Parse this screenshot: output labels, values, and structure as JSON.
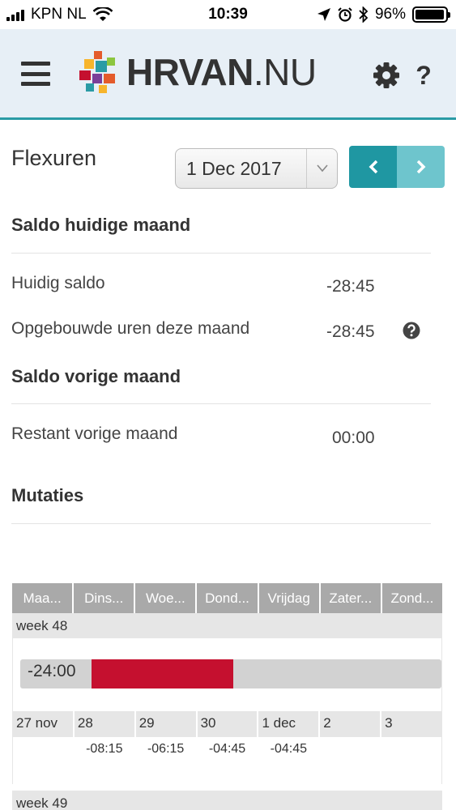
{
  "status_bar": {
    "carrier": "KPN NL",
    "time": "10:39",
    "battery_percent": "96%",
    "battery_level": 0.96
  },
  "header": {
    "logo_text_strong": "HRVAN",
    "logo_text_rest": ".NU",
    "help_label": "?"
  },
  "page": {
    "title": "Flexuren",
    "date_select_value": "1 Dec 2017"
  },
  "saldo_huidig": {
    "heading": "Saldo huidige maand",
    "rows": [
      {
        "label": "Huidig saldo",
        "value": "-28:45"
      },
      {
        "label": "Opgebouwde uren deze maand",
        "value": "-28:45"
      }
    ]
  },
  "saldo_vorig": {
    "heading": "Saldo vorige maand",
    "rows": [
      {
        "label": "Restant vorige maand",
        "value": "00:00"
      }
    ]
  },
  "mutaties": {
    "heading": "Mutaties",
    "day_headers": [
      "Maa...",
      "Dins...",
      "Woe...",
      "Dond...",
      "Vrijdag",
      "Zater...",
      "Zond..."
    ],
    "weeks": [
      {
        "label": "week 48",
        "saldo": "-24:00",
        "dates": [
          "27 nov",
          "28",
          "29",
          "30",
          "1 dec",
          "2",
          "3"
        ],
        "values": [
          "",
          "-08:15",
          "-06:15",
          "-04:45",
          "-04:45",
          "",
          ""
        ]
      },
      {
        "label": "week 49"
      }
    ]
  },
  "colors": {
    "accent": "#2a9ba5",
    "nav_prev": "#1f97a2",
    "nav_next": "#6ec5cd",
    "negative_bar": "#c5102f"
  }
}
